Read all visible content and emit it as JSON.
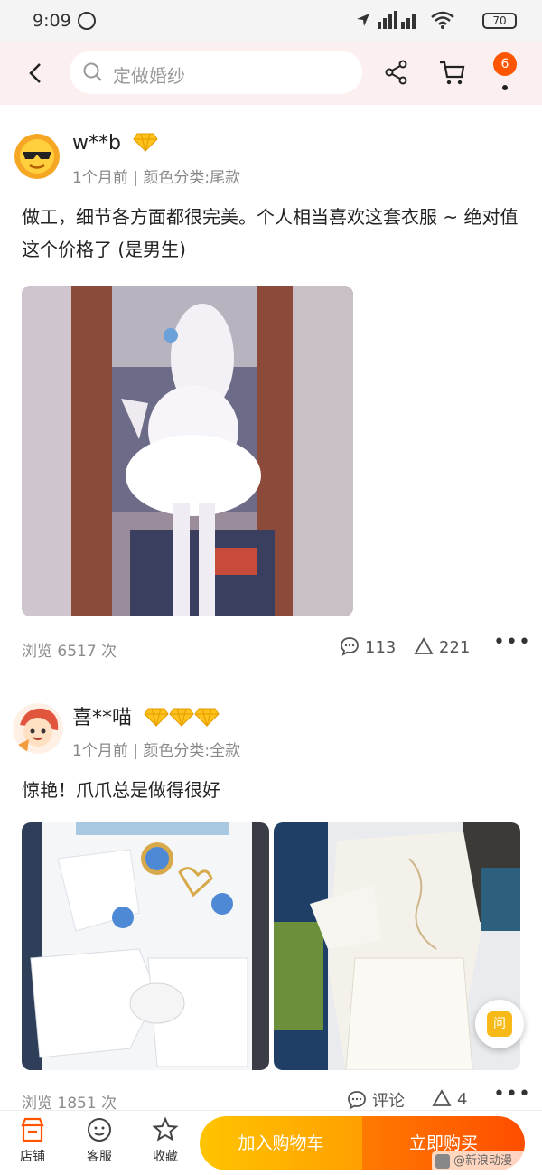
{
  "status_bar": {
    "time": "9:09",
    "battery": "70"
  },
  "header": {
    "search_placeholder": "定做婚纱",
    "more_badge": "6"
  },
  "reviews": [
    {
      "username": "w**b",
      "vip_level": 1,
      "time_ago": "1个月前",
      "variant": "颜色分类:尾款",
      "text": "做工，细节各方面都很完美。个人相当喜欢这套衣服 ~ 绝对值这个价格了 (是男生)",
      "views": "浏览 6517 次",
      "comments": "113",
      "likes": "221"
    },
    {
      "username": "喜**喵",
      "vip_level": 3,
      "time_ago": "1个月前",
      "variant": "颜色分类:全款",
      "text": "惊艳！爪爪总是做得很好",
      "views": "浏览 1851 次",
      "comment_label": "评论",
      "likes": "4"
    }
  ],
  "ask_button_label": "问",
  "bottom_bar": {
    "store_label": "店铺",
    "service_label": "客服",
    "favorite_label": "收藏",
    "add_to_cart_label": "加入购物车",
    "buy_now_label": "立即购买"
  },
  "watermark": "@新浪动漫"
}
